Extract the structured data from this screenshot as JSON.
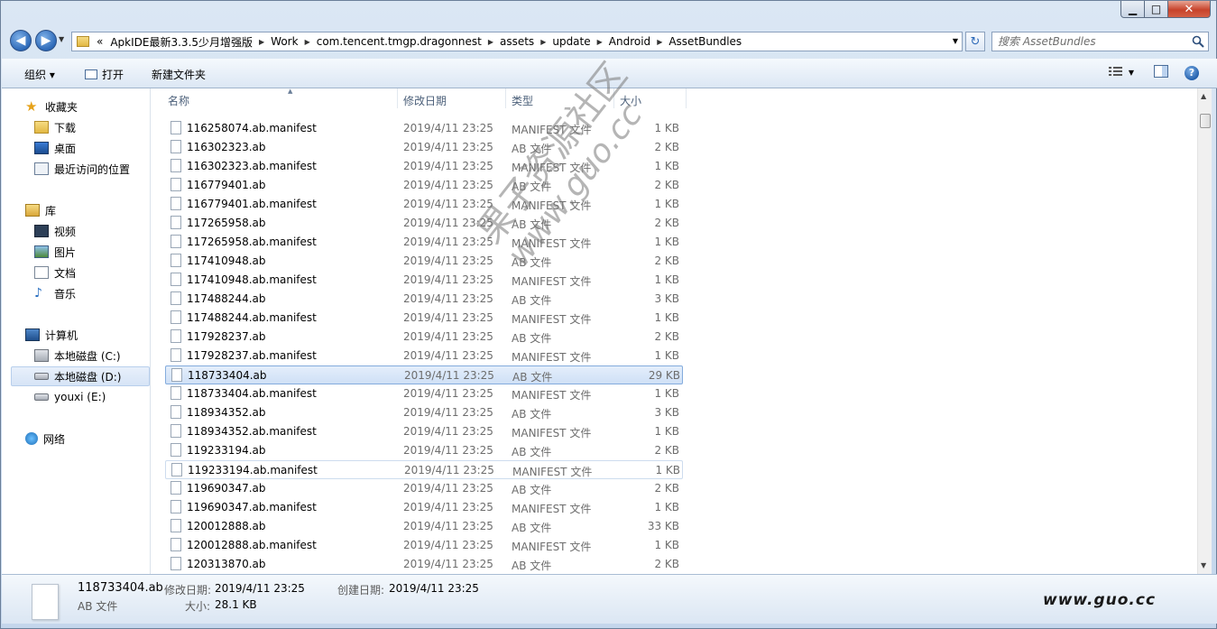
{
  "titlebar": {
    "min_glyph": "▁",
    "max_glyph": "□",
    "close_glyph": "✕"
  },
  "address": {
    "chevron": "«",
    "crumbs": [
      "ApkIDE最新3.3.5少月增强版",
      "Work",
      "com.tencent.tmgp.dragonnest",
      "assets",
      "update",
      "Android",
      "AssetBundles"
    ]
  },
  "search": {
    "placeholder": "搜索 AssetBundles"
  },
  "toolbar": {
    "organize_label": "组织 ▾",
    "open_label": "打开",
    "new_folder_label": "新建文件夹"
  },
  "sidebar": {
    "favorites_label": "收藏夹",
    "favorites": [
      "下载",
      "桌面",
      "最近访问的位置"
    ],
    "libraries_label": "库",
    "libraries": [
      "视频",
      "图片",
      "文档",
      "音乐"
    ],
    "computer_label": "计算机",
    "drives": [
      "本地磁盘 (C:)",
      "本地磁盘 (D:)",
      "youxi (E:)"
    ],
    "network_label": "网络"
  },
  "columns": {
    "name": "名称",
    "date": "修改日期",
    "type": "类型",
    "size": "大小"
  },
  "files": [
    {
      "name": "116258074.ab.manifest",
      "date": "2019/4/11 23:25",
      "type": "MANIFEST 文件",
      "size": "1 KB"
    },
    {
      "name": "116302323.ab",
      "date": "2019/4/11 23:25",
      "type": "AB 文件",
      "size": "2 KB"
    },
    {
      "name": "116302323.ab.manifest",
      "date": "2019/4/11 23:25",
      "type": "MANIFEST 文件",
      "size": "1 KB"
    },
    {
      "name": "116779401.ab",
      "date": "2019/4/11 23:25",
      "type": "AB 文件",
      "size": "2 KB"
    },
    {
      "name": "116779401.ab.manifest",
      "date": "2019/4/11 23:25",
      "type": "MANIFEST 文件",
      "size": "1 KB"
    },
    {
      "name": "117265958.ab",
      "date": "2019/4/11 23:25",
      "type": "AB 文件",
      "size": "2 KB"
    },
    {
      "name": "117265958.ab.manifest",
      "date": "2019/4/11 23:25",
      "type": "MANIFEST 文件",
      "size": "1 KB"
    },
    {
      "name": "117410948.ab",
      "date": "2019/4/11 23:25",
      "type": "AB 文件",
      "size": "2 KB"
    },
    {
      "name": "117410948.ab.manifest",
      "date": "2019/4/11 23:25",
      "type": "MANIFEST 文件",
      "size": "1 KB"
    },
    {
      "name": "117488244.ab",
      "date": "2019/4/11 23:25",
      "type": "AB 文件",
      "size": "3 KB"
    },
    {
      "name": "117488244.ab.manifest",
      "date": "2019/4/11 23:25",
      "type": "MANIFEST 文件",
      "size": "1 KB"
    },
    {
      "name": "117928237.ab",
      "date": "2019/4/11 23:25",
      "type": "AB 文件",
      "size": "2 KB"
    },
    {
      "name": "117928237.ab.manifest",
      "date": "2019/4/11 23:25",
      "type": "MANIFEST 文件",
      "size": "1 KB"
    },
    {
      "name": "118733404.ab",
      "date": "2019/4/11 23:25",
      "type": "AB 文件",
      "size": "29 KB"
    },
    {
      "name": "118733404.ab.manifest",
      "date": "2019/4/11 23:25",
      "type": "MANIFEST 文件",
      "size": "1 KB"
    },
    {
      "name": "118934352.ab",
      "date": "2019/4/11 23:25",
      "type": "AB 文件",
      "size": "3 KB"
    },
    {
      "name": "118934352.ab.manifest",
      "date": "2019/4/11 23:25",
      "type": "MANIFEST 文件",
      "size": "1 KB"
    },
    {
      "name": "119233194.ab",
      "date": "2019/4/11 23:25",
      "type": "AB 文件",
      "size": "2 KB"
    },
    {
      "name": "119233194.ab.manifest",
      "date": "2019/4/11 23:25",
      "type": "MANIFEST 文件",
      "size": "1 KB"
    },
    {
      "name": "119690347.ab",
      "date": "2019/4/11 23:25",
      "type": "AB 文件",
      "size": "2 KB"
    },
    {
      "name": "119690347.ab.manifest",
      "date": "2019/4/11 23:25",
      "type": "MANIFEST 文件",
      "size": "1 KB"
    },
    {
      "name": "120012888.ab",
      "date": "2019/4/11 23:25",
      "type": "AB 文件",
      "size": "33 KB"
    },
    {
      "name": "120012888.ab.manifest",
      "date": "2019/4/11 23:25",
      "type": "MANIFEST 文件",
      "size": "1 KB"
    },
    {
      "name": "120313870.ab",
      "date": "2019/4/11 23:25",
      "type": "AB 文件",
      "size": "2 KB"
    }
  ],
  "selected_index": 13,
  "hover_index": 18,
  "details": {
    "name": "118733404.ab",
    "type": "AB 文件",
    "modified_label": "修改日期:",
    "modified_value": "2019/4/11 23:25",
    "size_label": "大小:",
    "size_value": "28.1 KB",
    "created_label": "创建日期:",
    "created_value": "2019/4/11 23:25"
  },
  "watermark": {
    "site": "www.guo.cc",
    "cn": "果子资源社区",
    "url": "www.guo.cc"
  },
  "colors": {
    "selection_bg": "#cfe0f6",
    "selection_border": "#84acdd",
    "accent": "#2d69b8"
  }
}
